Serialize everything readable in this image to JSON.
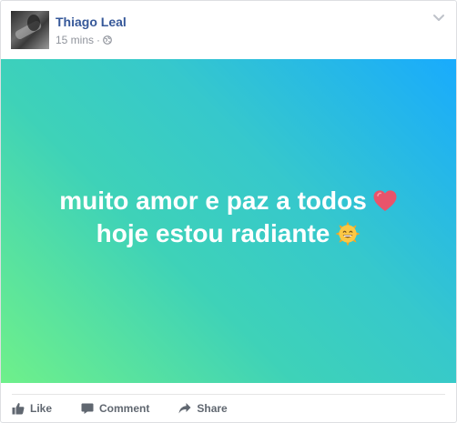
{
  "post": {
    "author": "Thiago Leal",
    "timestamp": "15 mins",
    "separator_dot": "·",
    "privacy_icon": "globe-icon",
    "menu_icon": "chevron-down-icon",
    "background": {
      "gradient_start": "#6ff08a",
      "gradient_end": "#19abfd"
    },
    "text_lines": [
      {
        "text": "muito amor e paz a todos",
        "emoji": "heart-emoji"
      },
      {
        "text": "hoje estou radiante",
        "emoji": "grinning-sun-emoji"
      }
    ]
  },
  "actions": [
    {
      "label": "Like",
      "icon": "thumbs-up-icon"
    },
    {
      "label": "Comment",
      "icon": "comment-icon"
    },
    {
      "label": "Share",
      "icon": "share-icon"
    }
  ],
  "colors": {
    "author_link": "#365899",
    "meta_text": "#90949c",
    "action_text": "#606770",
    "post_text": "#ffffff"
  }
}
